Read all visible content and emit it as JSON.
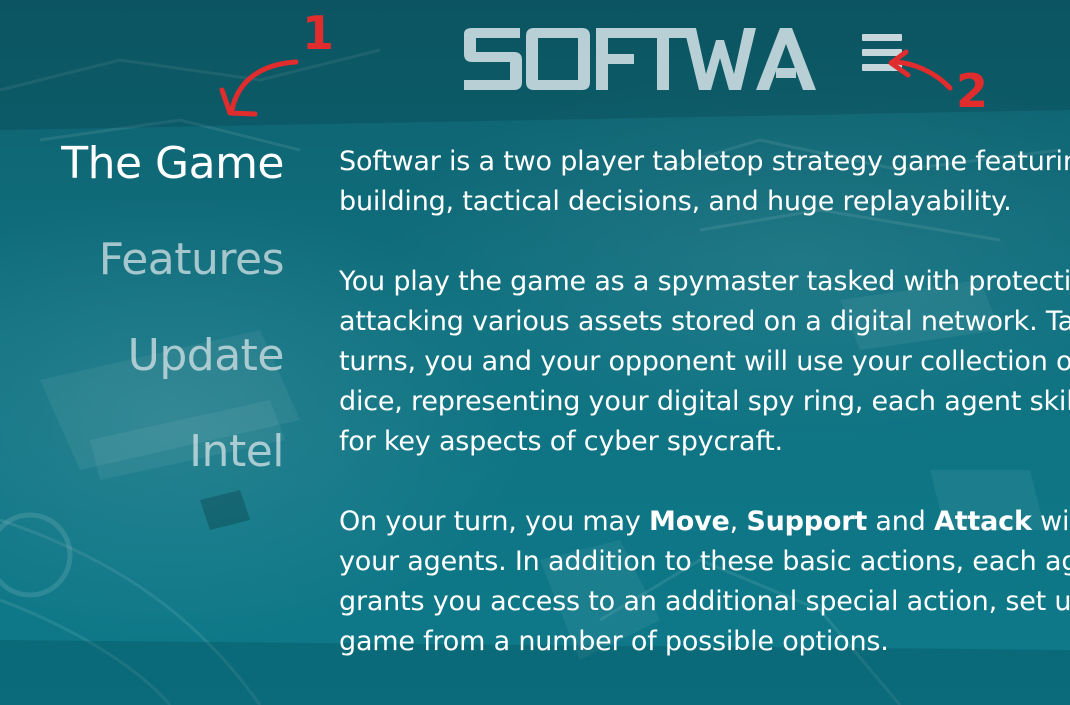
{
  "brand": {
    "logo_text": "SOFTWAR",
    "menu_icon": "hamburger-menu-icon"
  },
  "nav": {
    "items": [
      {
        "label": "The Game",
        "active": true
      },
      {
        "label": "Features",
        "active": false
      },
      {
        "label": "Update",
        "active": false
      },
      {
        "label": "Intel",
        "active": false
      }
    ]
  },
  "content": {
    "p1": {
      "line1": "Softwar is a two player tabletop strategy game featuring",
      "line2": "building, tactical decisions, and huge replayability."
    },
    "p2": {
      "line1": "You play the game as a spymaster tasked with protecting and",
      "line2": "attacking various assets stored on a digital network. Taking",
      "line3": "turns, you and your opponent will use your collection of",
      "line4": "dice, representing your digital spy ring, each agent skilled",
      "line5": "for key aspects of cyber spycraft."
    },
    "p3": {
      "line1_a": "On your turn, you may ",
      "move": "Move",
      "sep1": ", ",
      "support": "Support",
      "and": " and ",
      "attack": "Attack",
      "line1_b": " with",
      "line2": "your agents. In addition to these basic actions, each agent",
      "line3": "grants you access to an additional special action, set up each",
      "line4": "game from a number of possible options."
    }
  },
  "annotations": {
    "num1": "1",
    "num2": "2",
    "color": "#e02c2c"
  },
  "colors": {
    "background": "#0d6a78",
    "text": "#ffffff",
    "nav_inactive": "#dce8ea",
    "logo": "#b8cfd5"
  }
}
